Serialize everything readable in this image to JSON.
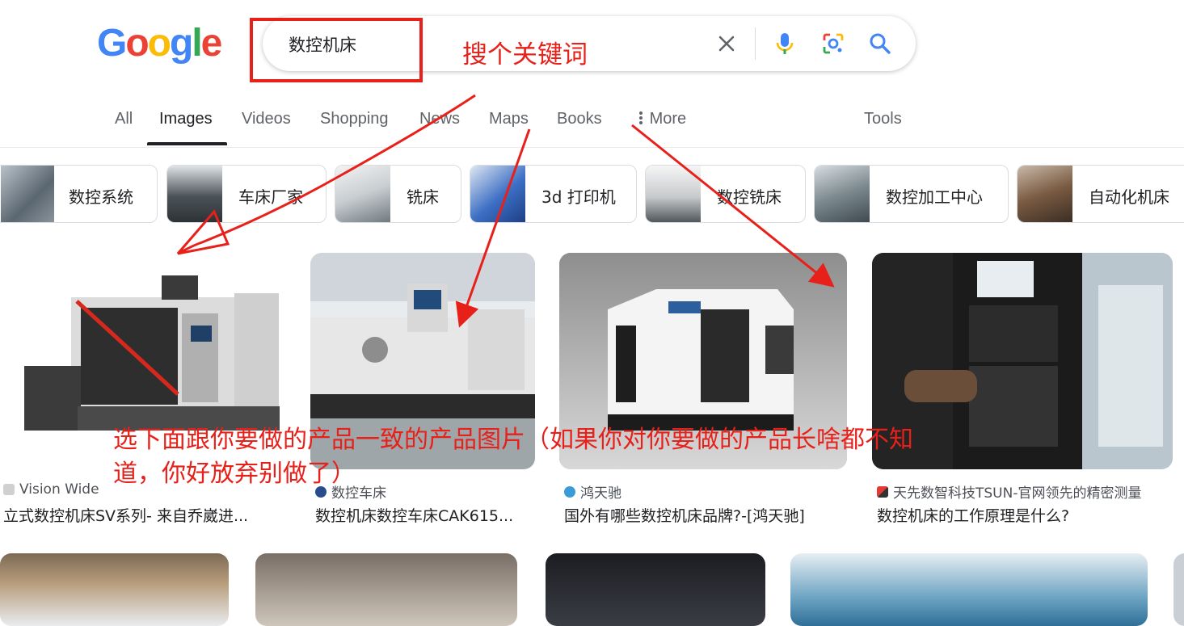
{
  "logo": {
    "text": "Google",
    "letters": [
      "G",
      "o",
      "o",
      "g",
      "l",
      "e"
    ]
  },
  "search": {
    "query": "数控机床"
  },
  "tabs": [
    {
      "label": "All"
    },
    {
      "label": "Images"
    },
    {
      "label": "Videos"
    },
    {
      "label": "Shopping"
    },
    {
      "label": "News"
    },
    {
      "label": "Maps"
    },
    {
      "label": "Books"
    },
    {
      "label": "More"
    }
  ],
  "tools_label": "Tools",
  "chips": [
    {
      "label": "数控系统"
    },
    {
      "label": "车床厂家"
    },
    {
      "label": "铣床"
    },
    {
      "label": "3d 打印机"
    },
    {
      "label": "数控铣床"
    },
    {
      "label": "数控加工中心"
    },
    {
      "label": "自动化机床"
    }
  ],
  "results": [
    {
      "source": "Vision Wide",
      "title": "立式数控机床SV系列- 来自乔崴进..."
    },
    {
      "source": "数控车床",
      "title": "数控机床数控车床CAK615..."
    },
    {
      "source": "鸿天驰",
      "title": "国外有哪些数控机床品牌?-[鸿天驰]"
    },
    {
      "source": "天先数智科技TSUN-官网领先的精密测量",
      "title": "数控机床的工作原理是什么?"
    }
  ],
  "annotations": {
    "search_hint": "搜个关键词",
    "select_hint_line1": "选下面跟你要做的产品一致的产品图片（如果你对你要做的产品长啥都不知",
    "select_hint_line2": "道，你好放弃别做了）"
  },
  "colors": {
    "annotation_red": "#e8201a",
    "google_blue": "#4285f4",
    "google_red": "#ea4335",
    "google_yellow": "#fbbc05",
    "google_green": "#34a853"
  }
}
